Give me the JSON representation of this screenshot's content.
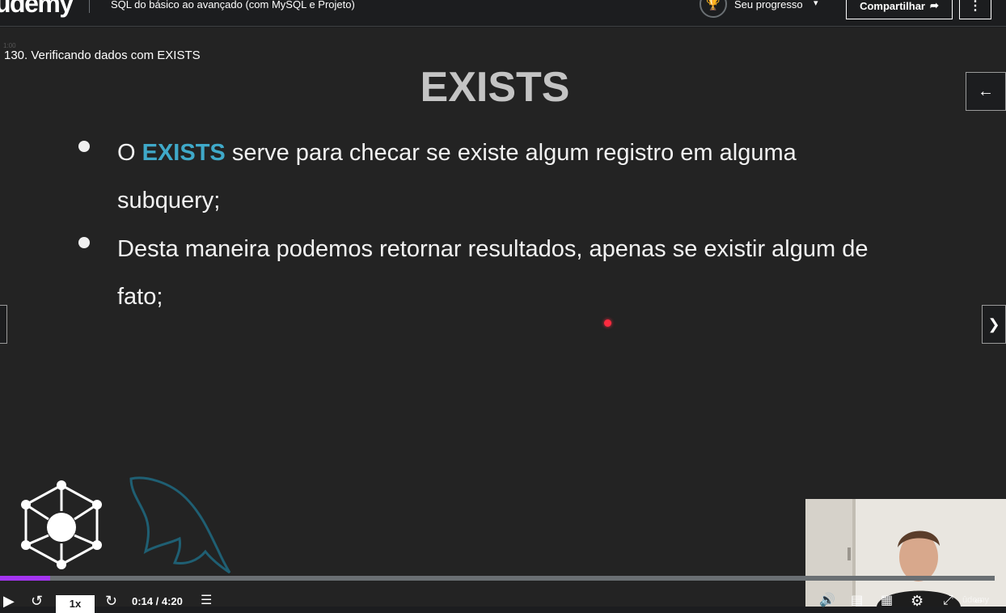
{
  "header": {
    "logo": "ûdemy",
    "course_title": "SQL do básico ao avançado (com MySQL e Projeto)",
    "progress_label": "Seu progresso",
    "share_label": "Compartilhar"
  },
  "lecture": {
    "timestamp_tiny": "1:00",
    "title": "130. Verificando dados com EXISTS"
  },
  "slide": {
    "title": "EXISTS",
    "bullet1": {
      "prefix": "O ",
      "keyword": "EXISTS",
      "rest_line1": " serve para checar se existe algum registro em alguma",
      "line2": "subquery;"
    },
    "bullet2": {
      "line1": "Desta maneira podemos retornar resultados, apenas se existir algum de",
      "line2": "fato;"
    },
    "keyword_color": "#3fa9c9"
  },
  "player": {
    "speed": "1x",
    "time": "0:14 / 4:20",
    "progress_fraction": 0.05,
    "watermark": "ûdemy"
  },
  "icons": {
    "trophy": "trophy-icon",
    "share": "share-arrow-icon",
    "more": "vertical-dots-icon",
    "back": "arrow-left-icon",
    "next": "chevron-right-icon",
    "play": "play-icon",
    "rewind": "rewind-icon",
    "forward": "forward-icon",
    "notes": "notes-icon",
    "volume": "volume-icon",
    "transcript": "transcript-icon",
    "captions": "captions-icon",
    "settings": "gear-icon",
    "fullscreen": "fullscreen-icon",
    "expand": "expand-icon"
  },
  "colors": {
    "brand_purple": "#a435f0",
    "background": "#1c1d1f"
  }
}
